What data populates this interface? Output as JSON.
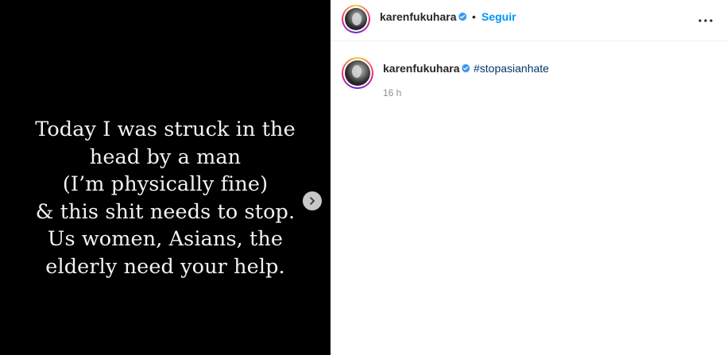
{
  "post": {
    "media_text_lines": [
      "Today I was struck in the",
      "head by a man",
      "(I’m physically fine)",
      "& this shit needs to stop.",
      "Us women, Asians, the",
      "elderly need your help."
    ],
    "next_icon": "chevron-right-icon"
  },
  "header": {
    "username": "karenfukuhara",
    "verified_icon": "verified-badge-icon",
    "separator": "•",
    "follow_label": "Seguir",
    "more_icon": "more-options-icon"
  },
  "caption": {
    "username": "karenfukuhara",
    "hashtag": "#stopasianhate",
    "time": "16 h"
  },
  "colors": {
    "accent": "#0095f6",
    "hashtag": "#00376b",
    "verified": "#3897f0",
    "muted": "#8e8e8e"
  }
}
